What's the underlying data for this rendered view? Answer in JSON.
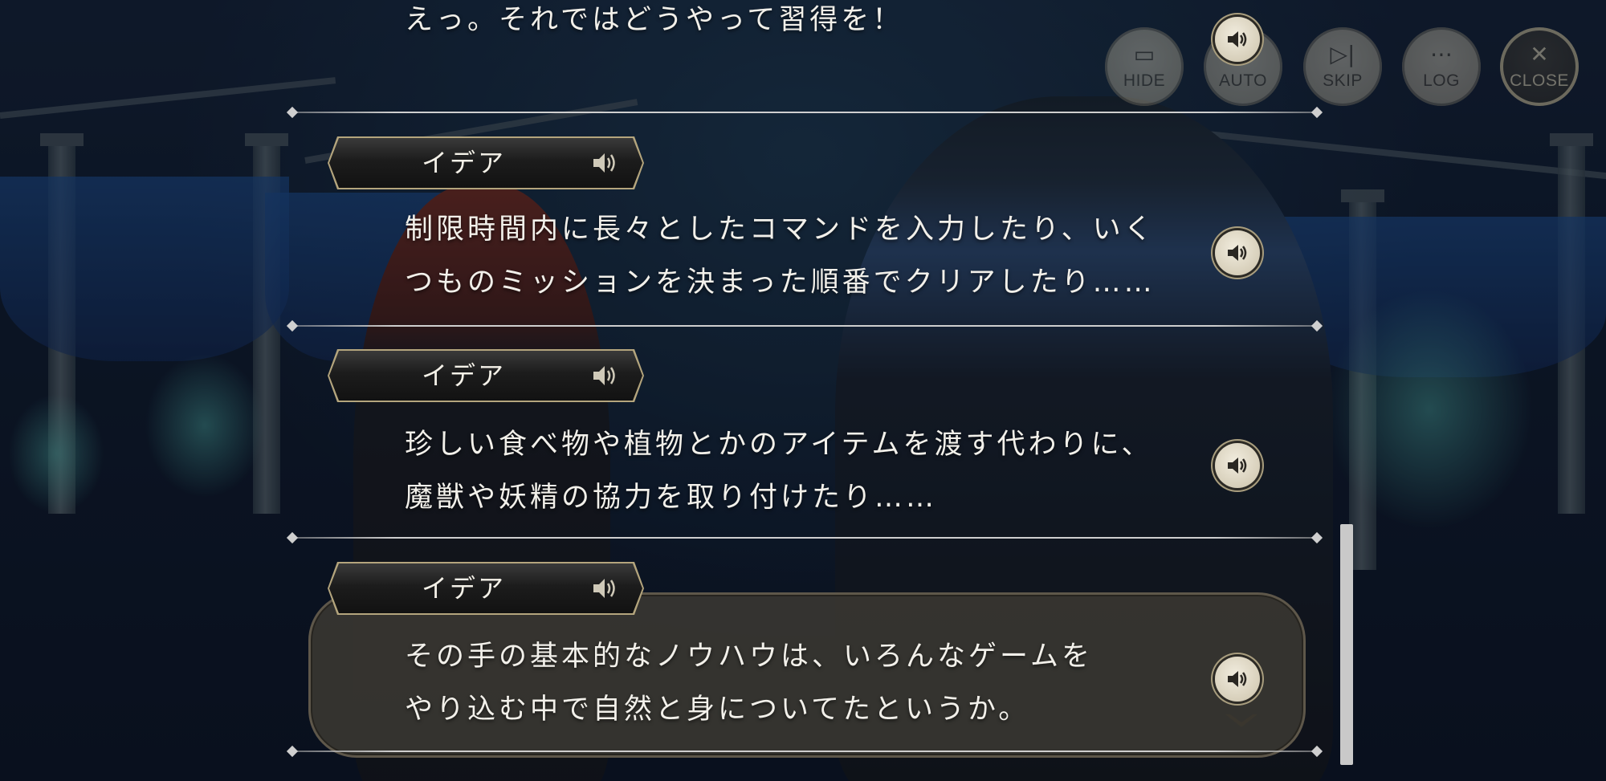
{
  "controls": {
    "hide_label": "HIDE",
    "auto_label": "AUTO",
    "skip_label": "SKIP",
    "log_label": "LOG",
    "close_label": "CLOSE"
  },
  "log_entries": [
    {
      "speaker": "",
      "lines": [
        "えっ。それではどうやって習得を！"
      ]
    },
    {
      "speaker": "イデア",
      "lines": [
        "制限時間内に長々としたコマンドを入力したり、いく",
        "つものミッションを決まった順番でクリアしたり……"
      ]
    },
    {
      "speaker": "イデア",
      "lines": [
        "珍しい食べ物や植物とかのアイテムを渡す代わりに、",
        "魔獣や妖精の協力を取り付けたり……"
      ]
    },
    {
      "speaker": "イデア",
      "lines": [
        "その手の基本的なノウハウは、いろんなゲームを",
        "やり込む中で自然と身についてたというか。"
      ]
    }
  ],
  "colors": {
    "accent_gold": "#b4a57d",
    "text": "#f2f0ea"
  },
  "icons": {
    "voice": "speaker-icon",
    "hide": "hide-icon",
    "auto": "auto-icon",
    "skip": "skip-icon",
    "log": "log-icon",
    "close": "close-icon"
  }
}
